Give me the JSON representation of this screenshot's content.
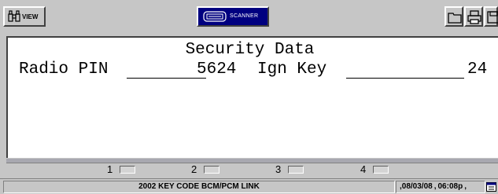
{
  "toolbar": {
    "view_label": "VIEW",
    "scanner_label": "SCANNER"
  },
  "display": {
    "title": "Security Data",
    "fields": [
      {
        "label": "Radio PIN",
        "value": "5624"
      },
      {
        "label": "Ign Key",
        "value": "24"
      }
    ]
  },
  "pages": [
    "1",
    "2",
    "3",
    "4"
  ],
  "status": {
    "description": "2002 KEY CODE BCM/PCM LINK",
    "date": "08/03/08",
    "time": "06:08p"
  },
  "colors": {
    "scanner_button_bg": "#000080",
    "chrome_bg": "#c6c6c6",
    "display_bg": "#ffffff"
  }
}
